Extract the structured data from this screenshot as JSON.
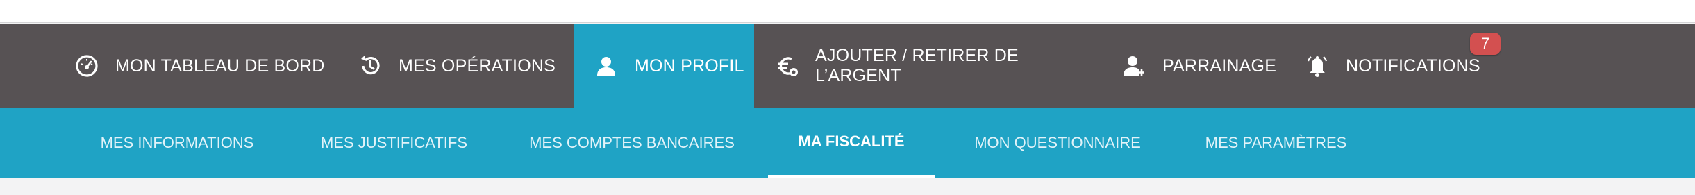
{
  "main_nav": {
    "items": [
      {
        "label": "MON TABLEAU DE BORD",
        "icon": "dashboard-gauge-icon"
      },
      {
        "label": "MES OPÉRATIONS",
        "icon": "history-clock-icon"
      },
      {
        "label": "MON PROFIL",
        "icon": "user-icon",
        "active": true
      },
      {
        "label": "AJOUTER / RETIRER DE L’ARGENT",
        "icon": "euro-money-icon"
      },
      {
        "label": "PARRAINAGE",
        "icon": "user-add-icon"
      },
      {
        "label": "NOTIFICATIONS",
        "icon": "bell-icon"
      }
    ],
    "notifications_count": "7"
  },
  "sub_nav": {
    "items": [
      {
        "label": "MES INFORMATIONS"
      },
      {
        "label": "MES JUSTIFICATIFS"
      },
      {
        "label": "MES COMPTES BANCAIRES"
      },
      {
        "label": "MA FISCALITÉ",
        "active": true
      },
      {
        "label": "MON QUESTIONNAIRE"
      },
      {
        "label": "MES PARAMÈTRES"
      }
    ]
  },
  "colors": {
    "main_nav_bg": "#575254",
    "accent": "#1fa3c5",
    "badge": "#d35050",
    "page_bg": "#f3f3f4"
  }
}
